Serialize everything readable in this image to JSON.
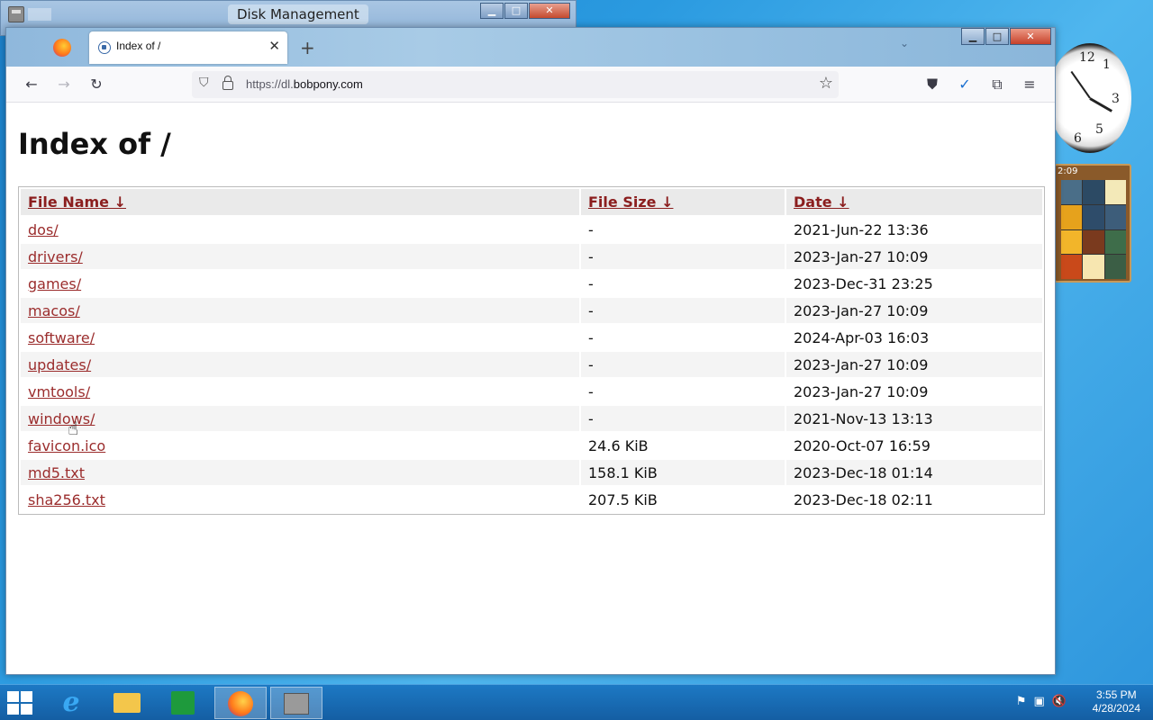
{
  "background_window": {
    "title": "Disk Management"
  },
  "browser": {
    "tab": {
      "title": "Index of /"
    },
    "url": {
      "prefix": "https://dl.",
      "domain": "bobpony.com"
    }
  },
  "page": {
    "heading": "Index of /",
    "columns": {
      "name": "File Name ↓",
      "size": "File Size ↓",
      "date": "Date ↓"
    },
    "rows": [
      {
        "name": "dos/",
        "size": "-",
        "date": "2021-Jun-22 13:36"
      },
      {
        "name": "drivers/",
        "size": "-",
        "date": "2023-Jan-27 10:09"
      },
      {
        "name": "games/",
        "size": "-",
        "date": "2023-Dec-31 23:25"
      },
      {
        "name": "macos/",
        "size": "-",
        "date": "2023-Jan-27 10:09"
      },
      {
        "name": "software/",
        "size": "-",
        "date": "2024-Apr-03 16:03"
      },
      {
        "name": "updates/",
        "size": "-",
        "date": "2023-Jan-27 10:09"
      },
      {
        "name": "vmtools/",
        "size": "-",
        "date": "2023-Jan-27 10:09"
      },
      {
        "name": "windows/",
        "size": "-",
        "date": "2021-Nov-13 13:13"
      },
      {
        "name": "favicon.ico",
        "size": "24.6 KiB",
        "date": "2020-Oct-07 16:59"
      },
      {
        "name": "md5.txt",
        "size": "158.1 KiB",
        "date": "2023-Dec-18 01:14"
      },
      {
        "name": "sha256.txt",
        "size": "207.5 KiB",
        "date": "2023-Dec-18 02:11"
      }
    ]
  },
  "gadgets": {
    "puzzle_time": "2:09"
  },
  "taskbar": {
    "time": "3:55 PM",
    "date": "4/28/2024"
  }
}
